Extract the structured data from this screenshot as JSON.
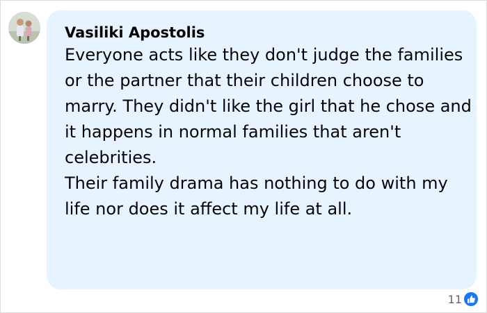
{
  "comment": {
    "author": "Vasiliki Apostolis",
    "paragraphs": [
      "Everyone acts like they don't judge the families or the partner that their children choose to marry. They didn't like the girl that he chose and it happens in normal families that aren't celebrities.",
      "Their family drama has nothing to do with my life nor does it affect my life at all."
    ],
    "reaction_count": "11",
    "reaction_icon": "like-thumb-icon"
  },
  "colors": {
    "bubble": "#e7f3ff",
    "text": "#050505",
    "meta": "#65676b",
    "like": "#1877f2"
  }
}
